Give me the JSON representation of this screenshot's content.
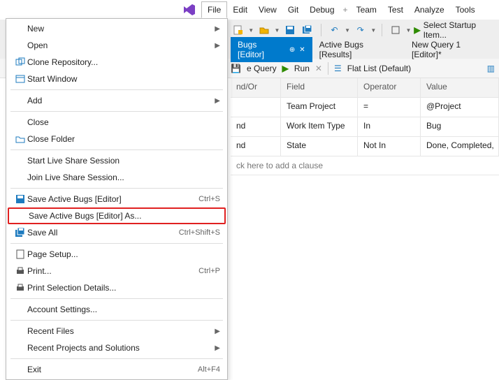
{
  "menubar": {
    "items": [
      "File",
      "Edit",
      "View",
      "Git",
      "Debug",
      "Team",
      "Test",
      "Analyze",
      "Tools"
    ]
  },
  "toolbar": {
    "startup_label": "Select Startup Item..."
  },
  "tabs": [
    {
      "label": "Bugs [Editor]",
      "active": true,
      "pinnable": true,
      "closable": true
    },
    {
      "label": "Active Bugs [Results]",
      "active": false
    },
    {
      "label": "New Query 1 [Editor]*",
      "active": false
    }
  ],
  "querybar": {
    "save_hint": "e Query",
    "run_label": "Run",
    "view_label": "Flat List (Default)"
  },
  "grid": {
    "headers": [
      "nd/Or",
      "Field",
      "Operator",
      "Value"
    ],
    "rows": [
      [
        "",
        "Team Project",
        "=",
        "@Project"
      ],
      [
        "nd",
        "Work Item Type",
        "In",
        "Bug"
      ],
      [
        "nd",
        "State",
        "Not In",
        "Done, Completed,"
      ]
    ],
    "add_clause": "ck here to add a clause"
  },
  "file_menu": {
    "groups": [
      [
        {
          "icon": "",
          "label": "New",
          "shortcut": "",
          "submenu": true
        },
        {
          "icon": "",
          "label": "Open",
          "shortcut": "",
          "submenu": true
        },
        {
          "icon": "clone",
          "label": "Clone Repository...",
          "shortcut": ""
        },
        {
          "icon": "window",
          "label": "Start Window",
          "shortcut": ""
        }
      ],
      [
        {
          "icon": "",
          "label": "Add",
          "shortcut": "",
          "submenu": true
        }
      ],
      [
        {
          "icon": "",
          "label": "Close",
          "shortcut": ""
        },
        {
          "icon": "folder",
          "label": "Close Folder",
          "shortcut": ""
        }
      ],
      [
        {
          "icon": "",
          "label": "Start Live Share Session",
          "shortcut": ""
        },
        {
          "icon": "",
          "label": "Join Live Share Session...",
          "shortcut": ""
        }
      ],
      [
        {
          "icon": "save",
          "label": "Save Active Bugs [Editor]",
          "shortcut": "Ctrl+S"
        },
        {
          "icon": "",
          "label": "Save Active Bugs [Editor] As...",
          "shortcut": "",
          "highlight": true
        },
        {
          "icon": "saveall",
          "label": "Save All",
          "shortcut": "Ctrl+Shift+S"
        }
      ],
      [
        {
          "icon": "page",
          "label": "Page Setup...",
          "shortcut": ""
        },
        {
          "icon": "print",
          "label": "Print...",
          "shortcut": "Ctrl+P"
        },
        {
          "icon": "print",
          "label": "Print Selection Details...",
          "shortcut": ""
        }
      ],
      [
        {
          "icon": "",
          "label": "Account Settings...",
          "shortcut": ""
        }
      ],
      [
        {
          "icon": "",
          "label": "Recent Files",
          "shortcut": "",
          "submenu": true
        },
        {
          "icon": "",
          "label": "Recent Projects and Solutions",
          "shortcut": "",
          "submenu": true
        }
      ],
      [
        {
          "icon": "",
          "label": "Exit",
          "shortcut": "Alt+F4"
        }
      ]
    ]
  }
}
